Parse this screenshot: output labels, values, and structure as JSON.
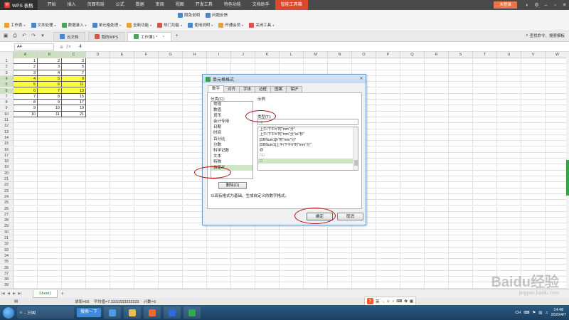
{
  "app": {
    "logo_text": "WPS 表格",
    "menu": [
      "开始",
      "插入",
      "页面布局",
      "公式",
      "数据",
      "审阅",
      "视图",
      "开发工具",
      "特色功能",
      "文档助手",
      "智能工具箱"
    ],
    "active_menu_index": 10,
    "login_label": "未登录"
  },
  "ribbon": {
    "row1": [
      {
        "label": "工作表",
        "icon": "worksheet-icon",
        "color": "orange"
      },
      {
        "label": "文本处理",
        "icon": "text-icon",
        "color": "blue"
      },
      {
        "label": "数据录入",
        "icon": "data-entry-icon",
        "color": "green"
      },
      {
        "label": "单元格处理",
        "icon": "cell-icon",
        "color": "blue"
      },
      {
        "label": "全新功能",
        "icon": "new-feature-icon",
        "color": "orange"
      },
      {
        "label": "热门功能",
        "icon": "hot-icon",
        "color": "red"
      },
      {
        "label": "使用说明",
        "icon": "help-icon",
        "color": "blue"
      },
      {
        "label": "开通会员",
        "icon": "vip-icon",
        "color": "orange"
      },
      {
        "label": "关闭工具",
        "icon": "close-tool-icon",
        "color": "red"
      }
    ],
    "extra_top": [
      {
        "label": "限免说明",
        "icon": "info-icon"
      },
      {
        "label": "问题反馈",
        "icon": "feedback-icon"
      }
    ]
  },
  "tabs": {
    "docs": [
      {
        "label": "云文档",
        "icon": "cloud-icon",
        "active": false
      },
      {
        "label": "我的WPS",
        "icon": "wps-icon",
        "active": false
      },
      {
        "label": "工作簿1 *",
        "icon": "sheet-icon",
        "active": true
      }
    ],
    "cmd_search": "查找命令、搜索模板"
  },
  "formula": {
    "namebox": "A4",
    "value": "4"
  },
  "grid": {
    "columns": [
      "A",
      "B",
      "C",
      "D",
      "E",
      "F",
      "G",
      "H",
      "I",
      "J",
      "K",
      "L",
      "M",
      "N",
      "O",
      "P",
      "Q",
      "R",
      "S",
      "T",
      "U",
      "V",
      "W"
    ],
    "selected_columns": [
      0,
      1,
      2
    ],
    "rows": [
      [
        "1",
        "2",
        "3"
      ],
      [
        "2",
        "3",
        "5"
      ],
      [
        "3",
        "4",
        "7"
      ],
      [
        "4",
        "5",
        "9"
      ],
      [
        "5",
        "6",
        "11"
      ],
      [
        "6",
        "7",
        "13"
      ],
      [
        "7",
        "8",
        "15"
      ],
      [
        "8",
        "9",
        "17"
      ],
      [
        "9",
        "10",
        "19"
      ],
      [
        "10",
        "11",
        "21"
      ]
    ],
    "highlighted_rows": [
      3,
      4,
      5
    ],
    "highlight_color": "#fbff3b",
    "row_count": 39
  },
  "sheets": {
    "tabs": [
      "Sheet1"
    ]
  },
  "status": {
    "sum": "求和=66",
    "avg": "平均值=7.3333333333333",
    "count": "计数=9"
  },
  "dialog": {
    "title": "单元格格式",
    "tabs": [
      "数字",
      "对齐",
      "字体",
      "边框",
      "图案",
      "保护"
    ],
    "active_tab_index": 0,
    "category_label": "分类(C):",
    "categories": [
      "常规",
      "数值",
      "货币",
      "会计专用",
      "日期",
      "时间",
      "百分比",
      "分数",
      "科学记数",
      "文本",
      "特殊",
      "自定义"
    ],
    "selected_category_index": 11,
    "sample_label": "示例",
    "type_label": "类型(T):",
    "type_value": ";;;",
    "formats": [
      "上午/下午h\"时\"mm\"分\"",
      "上午/下午h\"时\"mm\"分\"ss\"秒\"",
      "[DBNum1]h\"时\"mm\"分\"",
      "[DBNum1]上午/下午h\"时\"mm\"分\"",
      "@",
      "::;;;",
      ";;;"
    ],
    "selected_format_index": 6,
    "delete_label": "删除(D)",
    "description": "以现有格式为基础，生成自定义的数字格式。",
    "ok_label": "确定",
    "cancel_label": "取消"
  },
  "taskbar": {
    "ie_label": "- 三国",
    "search_label": "搜索一下",
    "ime_label": "英",
    "tray_lang": "CH",
    "time": "14:48",
    "date": "2020/4/7"
  },
  "watermark": {
    "text": "Baidu经验",
    "sub": "jingyan.baidu.com"
  }
}
